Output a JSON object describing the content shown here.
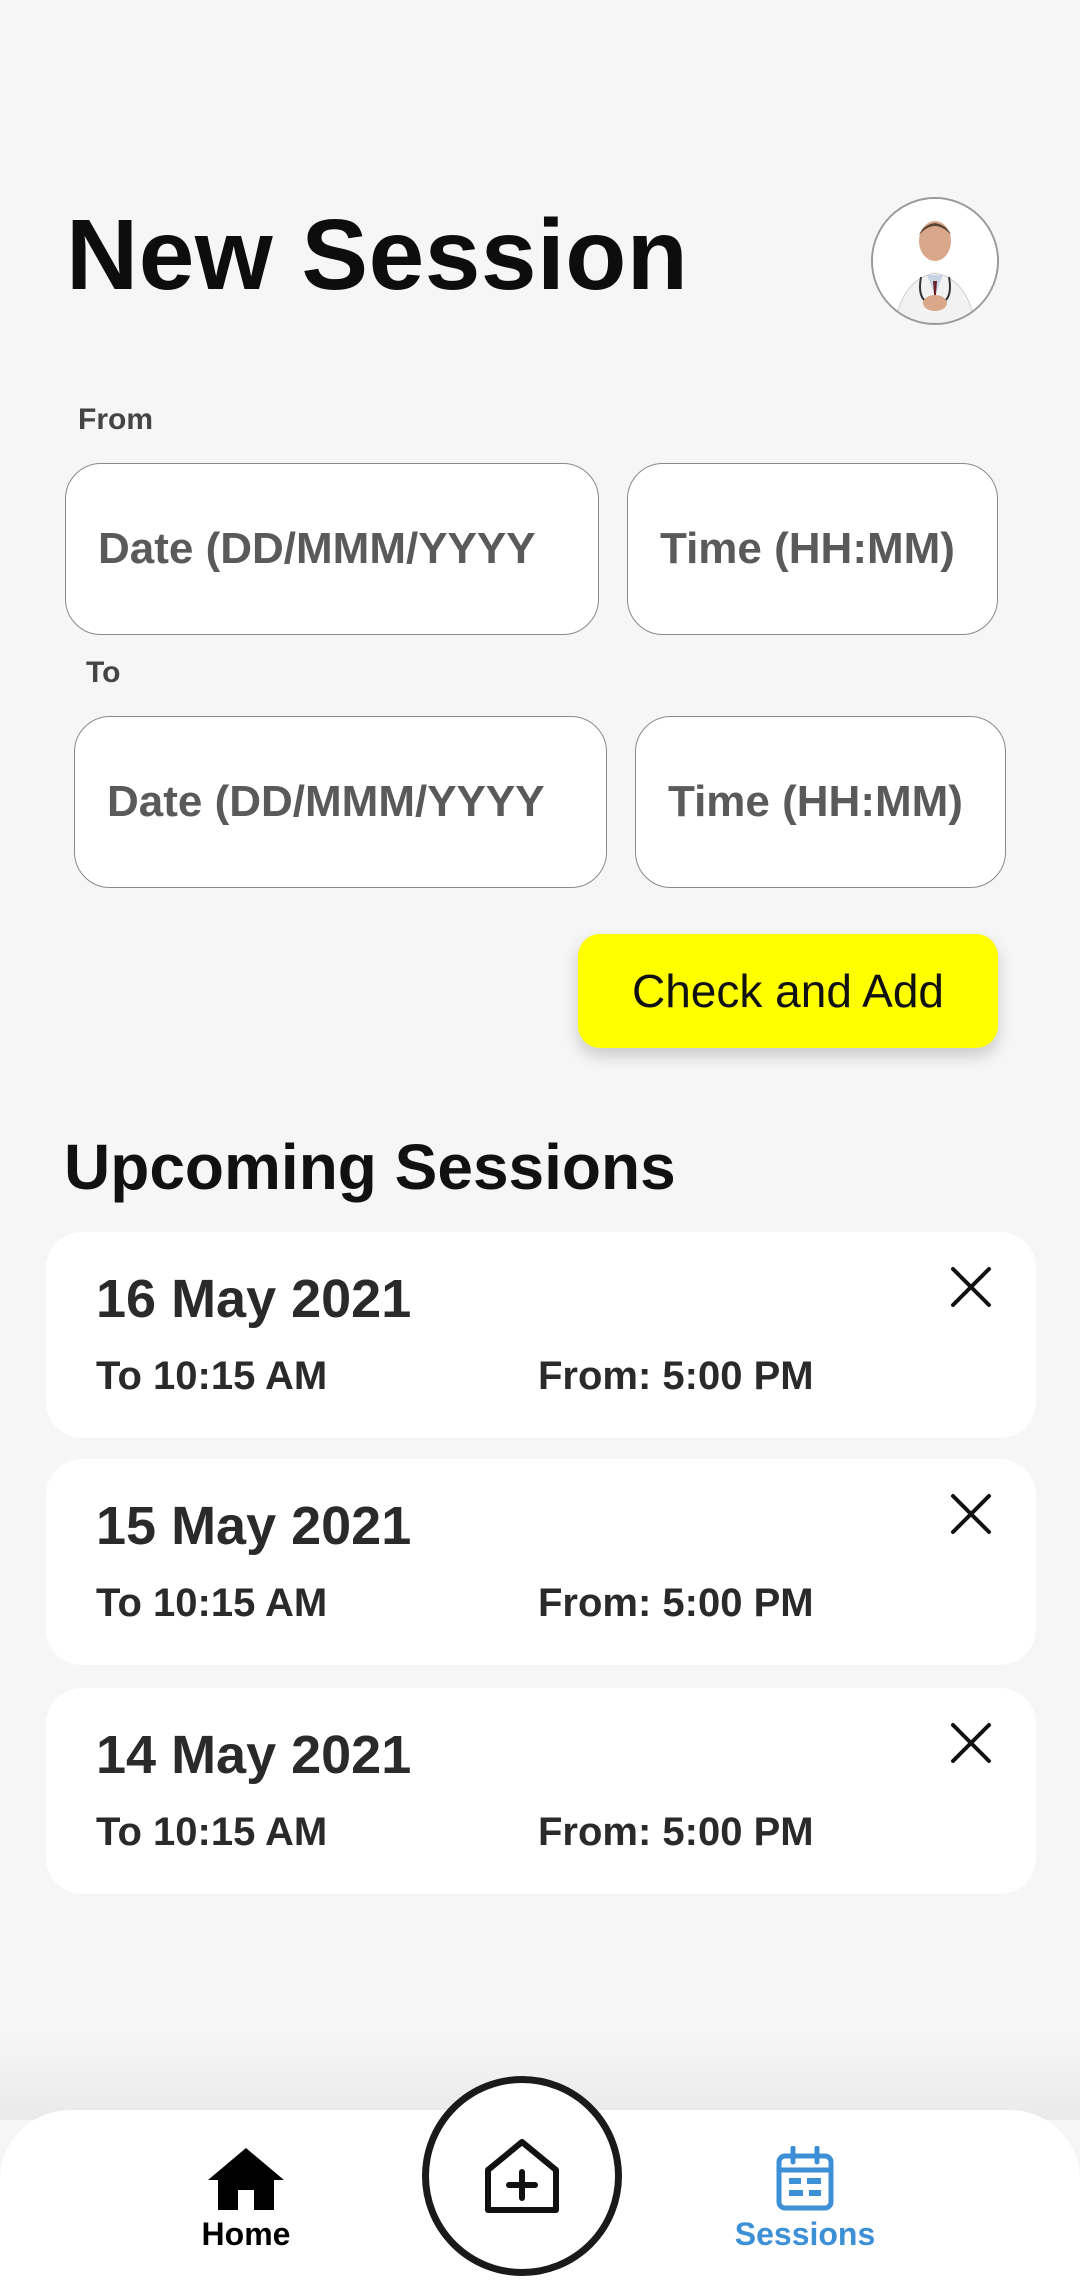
{
  "header": {
    "title": "New Session"
  },
  "form": {
    "from_label": "From",
    "to_label": "To",
    "from_date_placeholder": "Date (DD/MMM/YYYY",
    "from_time_placeholder": "Time (HH:MM)",
    "to_date_placeholder": "Date (DD/MMM/YYYY",
    "to_time_placeholder": "Time (HH:MM)",
    "submit_label": "Check and Add",
    "submit_color": "#ffff00"
  },
  "upcoming": {
    "title": "Upcoming Sessions",
    "sessions": [
      {
        "date": "16 May 2021",
        "to": "To 10:15 AM",
        "from": "From: 5:00 PM"
      },
      {
        "date": "15 May 2021",
        "to": "To 10:15 AM",
        "from": "From: 5:00 PM"
      },
      {
        "date": "14 May 2021",
        "to": "To 10:15 AM",
        "from": "From: 5:00 PM"
      }
    ]
  },
  "nav": {
    "home_label": "Home",
    "sessions_label": "Sessions",
    "active": "Sessions",
    "active_color": "#3d8fd6",
    "icons": [
      "home-icon",
      "add-hospital-icon",
      "calendar-icon"
    ]
  },
  "profile": {
    "avatar_icon": "doctor-avatar"
  }
}
